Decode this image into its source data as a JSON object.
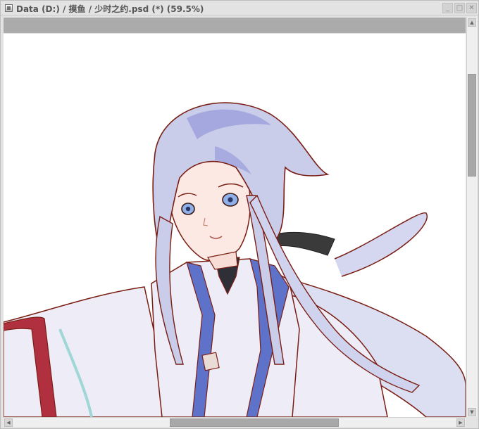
{
  "window": {
    "title": "Data (D:) / 摸鱼 / 少时之约.psd (*) (59.5%)",
    "buttons": {
      "minimize": "_",
      "maximize": "□",
      "close": "✕"
    }
  },
  "scrollbars": {
    "up_arrow": "▲",
    "down_arrow": "▼",
    "left_arrow": "◀",
    "right_arrow": "▶"
  },
  "icons": [
    "app-icon",
    "minimize-icon",
    "maximize-icon",
    "close-icon"
  ],
  "colors": {
    "hair": "#c9cdea",
    "hair_shade": "#8c90d6",
    "lineart": "#7a1e14",
    "skin": "#fce9e4",
    "robe": "#eeedf7",
    "robe_blue": "#5f72c9",
    "sleeve_red": "#b03040",
    "ribbon": "#3a3a3a"
  }
}
